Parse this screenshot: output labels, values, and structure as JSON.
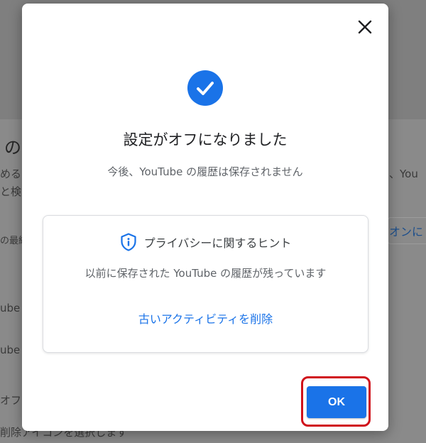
{
  "background": {
    "heading": "の",
    "line1_left": "める",
    "line1_right": "、You",
    "line2_left": "と検",
    "line3_left": "の最終",
    "button_label": "オンに",
    "row1": "ube",
    "row2": "ube",
    "row3": "オフ",
    "row4": "削除アイコンを選択します"
  },
  "dialog": {
    "close_icon": "close-icon",
    "status_icon": "check-circle-icon",
    "title": "設定がオフになりました",
    "subtitle": "今後、YouTube の履歴は保存されません",
    "tip": {
      "icon": "shield-info-icon",
      "title": "プライバシーに関するヒント",
      "body": "以前に保存された YouTube の履歴が残っています",
      "link": "古いアクティビティを削除"
    },
    "ok_label": "OK"
  },
  "colors": {
    "accent": "#1a73e8",
    "highlight_ring": "#d0121b"
  }
}
